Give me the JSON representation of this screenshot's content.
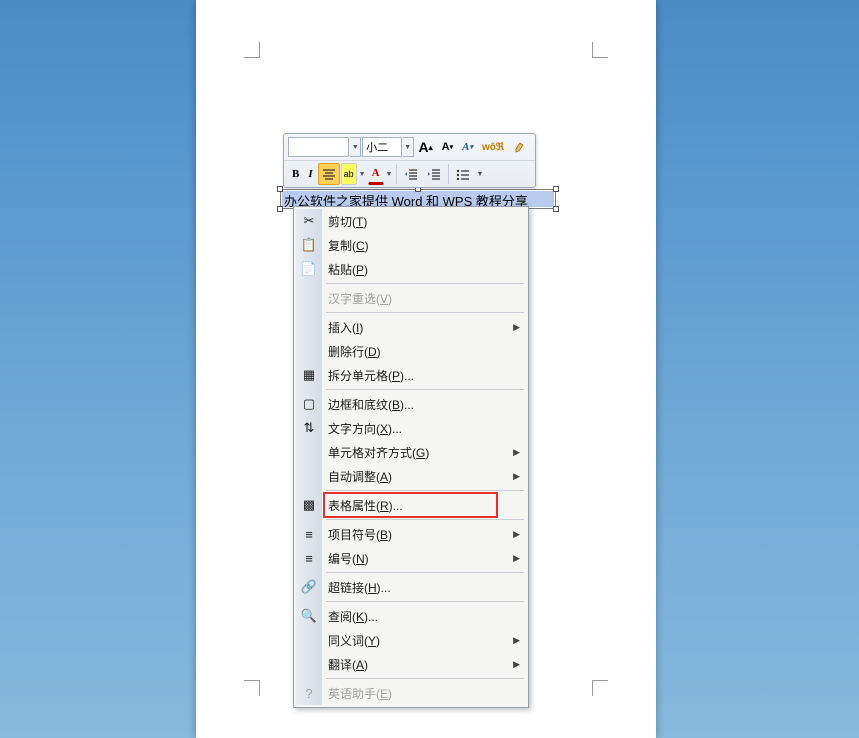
{
  "document": {
    "table_cell_text": "办公软件之家提供 Word 和 WPS 教程分享"
  },
  "mini_toolbar": {
    "font_name": "",
    "font_size": "小二",
    "row1": {
      "grow_font": "A",
      "shrink_font": "A",
      "style_gallery": "Aₐ",
      "format_painter": "✎"
    },
    "row2": {
      "bold": "B",
      "italic": "I",
      "center": "≡",
      "highlight": "ab",
      "font_color": "A",
      "indent_dec": "≣",
      "indent_inc": "≣",
      "bullets": "≡"
    }
  },
  "context_menu": {
    "items": [
      {
        "icon": "✂",
        "label": "剪切(T)",
        "key": "cut"
      },
      {
        "icon": "📋",
        "label": "复制(C)",
        "key": "copy"
      },
      {
        "icon": "📄",
        "label": "粘贴(P)",
        "key": "paste"
      },
      {
        "sep": true
      },
      {
        "label": "汉字重选(V)",
        "key": "reconvert",
        "disabled": true
      },
      {
        "sep": true
      },
      {
        "label": "插入(I)",
        "key": "insert",
        "sub": true
      },
      {
        "label": "删除行(D)",
        "key": "delete-row"
      },
      {
        "icon": "▦",
        "label": "拆分单元格(P)...",
        "key": "split-cells"
      },
      {
        "sep": true
      },
      {
        "icon": "▢",
        "label": "边框和底纹(B)...",
        "key": "borders-shading"
      },
      {
        "icon": "⇅",
        "label": "文字方向(X)...",
        "key": "text-direction"
      },
      {
        "label": "单元格对齐方式(G)",
        "key": "cell-align",
        "sub": true
      },
      {
        "label": "自动调整(A)",
        "key": "autofit",
        "sub": true
      },
      {
        "sep": true
      },
      {
        "icon": "▩",
        "label": "表格属性(R)...",
        "key": "table-properties",
        "highlight": true
      },
      {
        "sep": true
      },
      {
        "icon": "≡",
        "label": "项目符号(B)",
        "key": "bullets",
        "sub": true
      },
      {
        "icon": "≡",
        "label": "编号(N)",
        "key": "numbering",
        "sub": true
      },
      {
        "sep": true
      },
      {
        "icon": "🔗",
        "label": "超链接(H)...",
        "key": "hyperlink"
      },
      {
        "sep": true
      },
      {
        "icon": "🔍",
        "label": "查阅(K)...",
        "key": "lookup"
      },
      {
        "label": "同义词(Y)",
        "key": "synonyms",
        "sub": true
      },
      {
        "label": "翻译(A)",
        "key": "translate",
        "sub": true
      },
      {
        "sep": true
      },
      {
        "icon": "?",
        "label": "英语助手(E)",
        "key": "english-assistant",
        "disabled": true
      }
    ]
  }
}
